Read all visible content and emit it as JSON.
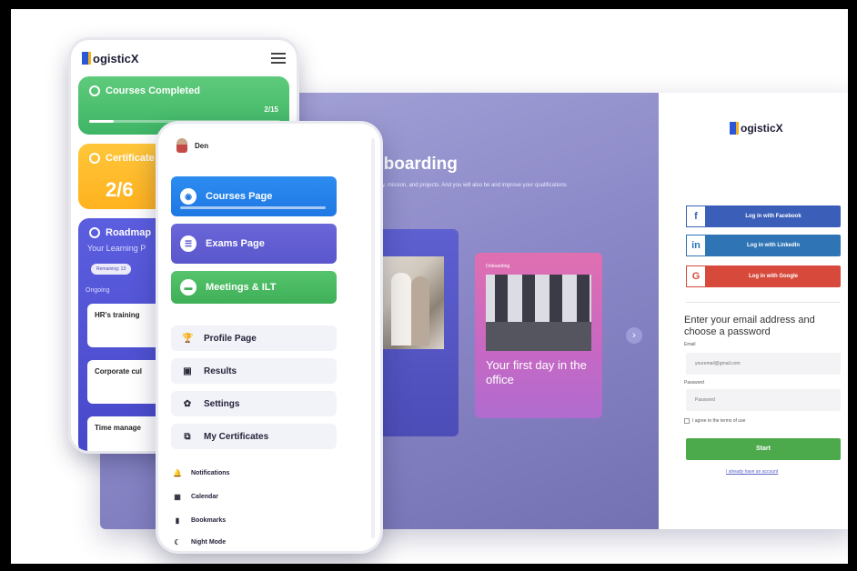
{
  "brand": {
    "name": "LogisticX",
    "logo_text": "ogisticX"
  },
  "desktop": {
    "heading": "nboarding",
    "subtext": "pany, mission, and projects. And you will also be and improve your qualifications",
    "card2_small": "Onboarding",
    "card2_title": "Your first day in the office",
    "next_icon": "chevron-right-icon",
    "next_glyph": "›"
  },
  "login": {
    "facebook": {
      "icon": "f",
      "label": "Log in with Facebook",
      "color": "#3b5fb8"
    },
    "linkedin": {
      "icon": "in",
      "label": "Log in with LinkedIn",
      "color": "#2f75b5"
    },
    "google": {
      "icon": "G",
      "label": "Log in with Google",
      "color": "#d6493b"
    },
    "prompt": "Enter your email address and choose a password",
    "email_label": "Email",
    "email_placeholder": "youremail@gmail.com",
    "password_label": "Password",
    "password_placeholder": "Password",
    "terms": "I agree to the terms of use",
    "start": "Start",
    "already": "I already have an account"
  },
  "phone_back": {
    "courses_completed": "Courses Completed",
    "courses_fraction": "2/15",
    "courses_progress": 0.13,
    "certificates": "Certificate",
    "certificates_value": "2/6",
    "roadmap": "Roadmap",
    "roadmap_sub": "Your Learning P",
    "remaining": "Remaining: 13",
    "ongoing": "Ongoing",
    "cards": [
      "HR's training",
      "Corporate cul",
      "Time manage"
    ]
  },
  "phone_front": {
    "user_name": "Den",
    "buttons": {
      "courses": "Courses Page",
      "exams": "Exams Page",
      "meetings": "Meetings & ILT"
    },
    "plain": {
      "profile": "Profile Page",
      "results": "Results",
      "settings": "Settings",
      "certs": "My Certificates"
    },
    "small": {
      "notifications": "Notifications",
      "calendar": "Calendar",
      "bookmarks": "Bookmarks",
      "night": "Night Mode"
    },
    "glyphs": {
      "courses": "◉",
      "exams": "☰",
      "meetings": "▬",
      "profile": "🏆",
      "results": "▣",
      "settings": "✿",
      "certs": "⧉",
      "notifications": "🔔",
      "calendar": "▦",
      "bookmarks": "▮",
      "night": "☾"
    }
  }
}
